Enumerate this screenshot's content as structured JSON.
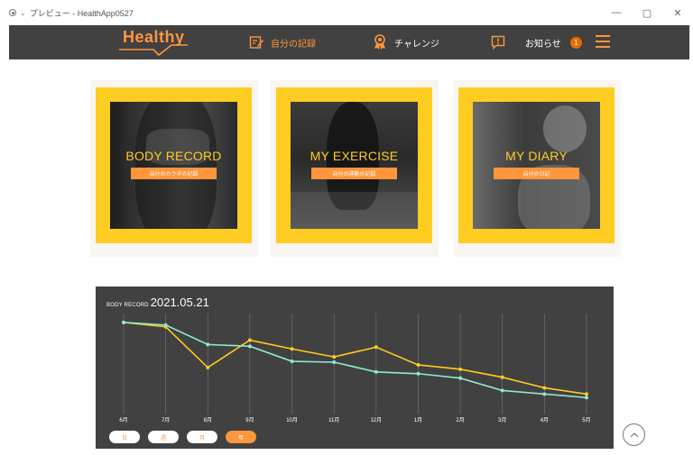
{
  "window": {
    "title": "プレビュー - HealthApp0527",
    "minimize": "—",
    "maximize": "▢",
    "close": "✕"
  },
  "header": {
    "logo": "Healthy",
    "nav": [
      {
        "label": "自分の記録",
        "icon": "memo-icon",
        "color": "#ff963c"
      },
      {
        "label": "チャレンジ",
        "icon": "medal-icon",
        "color": "#ffffff"
      },
      {
        "label": "お知らせ",
        "icon": "info-icon",
        "color": "#ffffff",
        "badge": "1"
      }
    ],
    "menu_icon": "hamburger-icon"
  },
  "tiles": [
    {
      "title": "BODY RECORD",
      "subtitle": "自分のカラダの記録"
    },
    {
      "title": "MY EXERCISE",
      "subtitle": "自分の運動の記録"
    },
    {
      "title": "MY DIARY",
      "subtitle": "自分の日記"
    }
  ],
  "chart": {
    "label": "BODY RECORD",
    "date": "2021.05.21",
    "range_buttons": [
      {
        "label": "日",
        "active": false
      },
      {
        "label": "週",
        "active": false
      },
      {
        "label": "月",
        "active": false
      },
      {
        "label": "年",
        "active": true
      }
    ]
  },
  "chart_data": {
    "type": "line",
    "categories": [
      "6月",
      "7月",
      "8月",
      "9月",
      "10月",
      "11月",
      "12月",
      "1月",
      "2月",
      "3月",
      "4月",
      "5月"
    ],
    "series": [
      {
        "color": "#ffcc21",
        "values": [
          100,
          95,
          49,
          80,
          70,
          61,
          72,
          52,
          47,
          38,
          26,
          19
        ]
      },
      {
        "color": "#8fe9d0",
        "values": [
          100,
          97,
          75,
          73,
          56,
          55,
          44,
          42,
          37,
          23,
          19,
          15
        ]
      }
    ],
    "ylim": [
      0,
      110
    ],
    "grid": "vertical",
    "colors": {
      "background": "#414141",
      "grid": "#777777",
      "text": "#ffffff"
    }
  },
  "scroll_top_icon": "chevron-up-icon"
}
